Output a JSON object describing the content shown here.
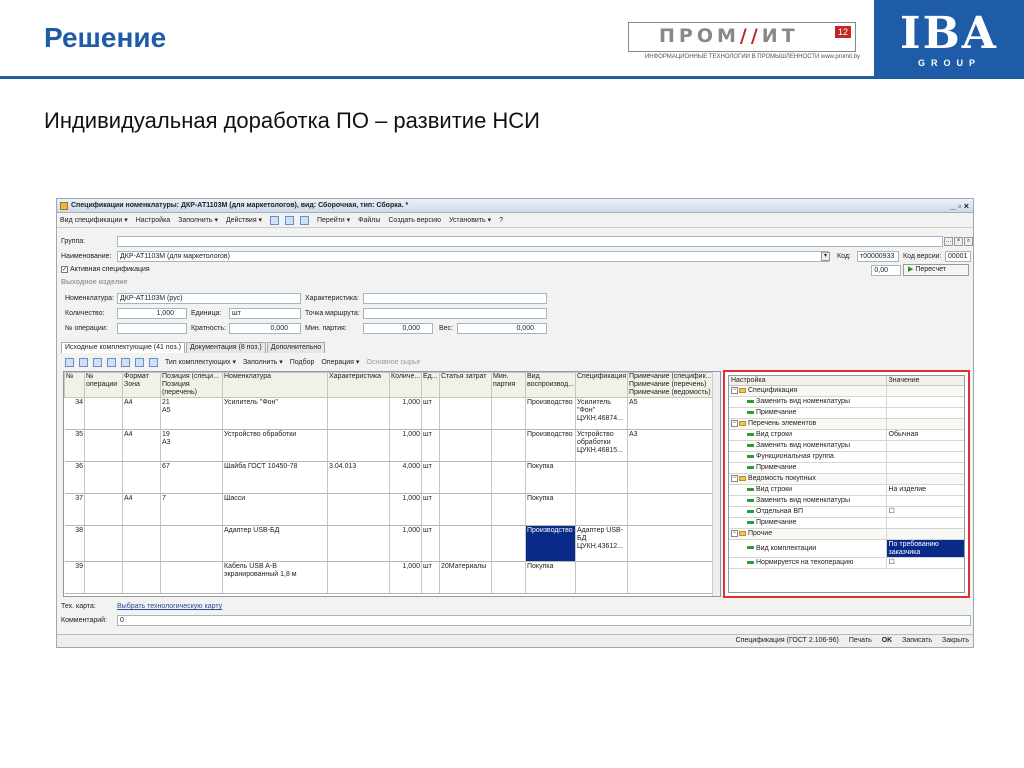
{
  "slide": {
    "title": "Решение",
    "subtitle": "Индивидуальная доработка ПО – развитие НСИ",
    "promit_logo_a": "ПРОМ",
    "promit_logo_b": "ИТ",
    "promit_badge": "12",
    "promit_tagline": "ИНФОРМАЦИОННЫЕ ТЕХНОЛОГИИ В ПРОМЫШЛЕННОСТИ www.promit.by",
    "iba_logo": "IBA",
    "iba_group": "GROUP",
    "brand_color": "#1f5ca8",
    "accent_color": "#c0272d",
    "highlight_border": "#e03030"
  },
  "window": {
    "title": "Спецификации номенклатуры: ДКР-АТ1103М (для маркетологов), вид: Сборочная, тип: Сборка. *",
    "controls": "_ ▫ ×",
    "toolbar": [
      "Вид спецификации ▾",
      "Настройка",
      "Заполнить ▾",
      "Действия ▾",
      "Перейти ▾",
      "Файлы",
      "Создать версию",
      "Установить ▾",
      "?"
    ],
    "form": {
      "group_label": "Группа:",
      "group_value": "",
      "name_label": "Наименование:",
      "name_value": "ДКР-АТ1103М (для маркетологов)",
      "code_label": "Код:",
      "code_value": "т00000933",
      "version_label": "Код версии:",
      "version_value": "00001",
      "active_label": "Активная спецификация",
      "active_checked": "✓",
      "ratio_value": "0,00",
      "recalc_button": "Пересчет",
      "output_section": "Выходное изделие",
      "nomenclature_label": "Номенклатура:",
      "nomenclature_value": "ДКР-АТ1103М (рус)",
      "characteristic_label": "Характеристика:",
      "characteristic_value": "",
      "quantity_label": "Количество:",
      "quantity_value": "1,000",
      "unit_label": "Единица:",
      "unit_value": "шт",
      "route_label": "Точка маршрута:",
      "route_value": "",
      "operation_label": "№ операции:",
      "operation_value": "",
      "multiplicity_label": "Кратность:",
      "multiplicity_value": "0,000",
      "min_batch_label": "Мин. партия:",
      "min_batch_value": "0,000",
      "weight_label": "Вес:",
      "weight_value": "0,000"
    },
    "tabs": [
      "Исходные комплектующие (41 поз.)",
      "Документация (8 поз.)",
      "Дополнительно"
    ],
    "grid_toolbar": [
      "Тип комплектующих ▾",
      "Заполнить ▾",
      "Подбор",
      "Операция ▾",
      "Основное сырье"
    ],
    "grid": {
      "headers": [
        "№",
        "№ операции",
        "Формат Зона",
        "Позиция (специ... Позиция (перечень)",
        "Номенклатура",
        "Характеристика",
        "Количе...",
        "Ед...",
        "Статья затрат",
        "Мин. партия",
        "Вид воспроизвод...",
        "Спецификация",
        "Примечание (специфик... Примечание (перечень) Примечание (ведомость)"
      ],
      "rows": [
        {
          "n": "34",
          "op": "",
          "fmt": "A4",
          "pos": "21\nA5",
          "nom": "Усилитель \"Фон\"",
          "char": "",
          "qty": "1,000",
          "unit": "шт",
          "cost": "",
          "min": "",
          "kind": "Производство",
          "spec": "Усилитель \"Фон\" ЦУКН.46874...",
          "note": "A5"
        },
        {
          "n": "35",
          "op": "",
          "fmt": "A4",
          "pos": "19\nA3",
          "nom": "Устройство обработки",
          "char": "",
          "qty": "1,000",
          "unit": "шт",
          "cost": "",
          "min": "",
          "kind": "Производство",
          "spec": "Устройство обработки ЦУКН.46815...",
          "note": "A3"
        },
        {
          "n": "36",
          "op": "",
          "fmt": "",
          "pos": "67",
          "nom": "Шайба ГОСТ 10450-78",
          "char": "3.04.013",
          "qty": "4,000",
          "unit": "шт",
          "cost": "",
          "min": "",
          "kind": "Покупка",
          "spec": "",
          "note": ""
        },
        {
          "n": "37",
          "op": "",
          "fmt": "A4",
          "pos": "7",
          "nom": "Шасси",
          "char": "",
          "qty": "1,000",
          "unit": "шт",
          "cost": "",
          "min": "",
          "kind": "Покупка",
          "spec": "",
          "note": ""
        },
        {
          "n": "38",
          "op": "",
          "fmt": "",
          "pos": "",
          "nom": "Адаптер USB-БД",
          "char": "",
          "qty": "1,000",
          "unit": "шт",
          "cost": "",
          "min": "",
          "kind": "Производство",
          "spec": "Адаптер USB-БД ЦУКН.43612...",
          "note": ""
        },
        {
          "n": "39",
          "op": "",
          "fmt": "",
          "pos": "",
          "nom": "Кабель USB A-B экранированный 1,8 м",
          "char": "",
          "qty": "1,000",
          "unit": "шт",
          "cost": "20Материалы",
          "min": "",
          "kind": "Покупка",
          "spec": "",
          "note": ""
        }
      ]
    },
    "tree": {
      "headers": [
        "Настройка",
        "Значение"
      ],
      "rows": [
        {
          "level": 0,
          "kind": "group",
          "label": "Спецификация",
          "value": ""
        },
        {
          "level": 1,
          "kind": "leaf",
          "label": "Заменить вид номенклатуры",
          "value": ""
        },
        {
          "level": 1,
          "kind": "leaf",
          "label": "Примечание",
          "value": ""
        },
        {
          "level": 0,
          "kind": "group",
          "label": "Перечень элементов",
          "value": ""
        },
        {
          "level": 1,
          "kind": "leaf",
          "label": "Вид строки",
          "value": "Обычная"
        },
        {
          "level": 1,
          "kind": "leaf",
          "label": "Заменить вид номенклатуры",
          "value": ""
        },
        {
          "level": 1,
          "kind": "leaf",
          "label": "Функциональная группа",
          "value": ""
        },
        {
          "level": 1,
          "kind": "leaf",
          "label": "Примечание",
          "value": ""
        },
        {
          "level": 0,
          "kind": "group",
          "label": "Ведомость покупных",
          "value": ""
        },
        {
          "level": 1,
          "kind": "leaf",
          "label": "Вид строки",
          "value": "На изделие"
        },
        {
          "level": 1,
          "kind": "leaf",
          "label": "Заменить вид номенклатуры",
          "value": ""
        },
        {
          "level": 1,
          "kind": "leaf",
          "label": "Отдельная ВП",
          "value": "☐"
        },
        {
          "level": 1,
          "kind": "leaf",
          "label": "Примечание",
          "value": ""
        },
        {
          "level": 0,
          "kind": "group",
          "label": "Прочие",
          "value": ""
        },
        {
          "level": 1,
          "kind": "leaf",
          "label": "Вид комплектации",
          "value": "По требованию заказчика"
        },
        {
          "level": 1,
          "kind": "leaf",
          "label": "Нормируется на техоперацию",
          "value": "☐"
        }
      ]
    },
    "tech_card_label": "Тех. карта:",
    "tech_card_link": "Выбрать технологическую карту",
    "comment_label": "Комментарий:",
    "comment_value": "0",
    "status": [
      "Спецификация (ГОСТ 2.106-96)",
      "Печать",
      "OK",
      "Записать",
      "Закрыть"
    ]
  }
}
